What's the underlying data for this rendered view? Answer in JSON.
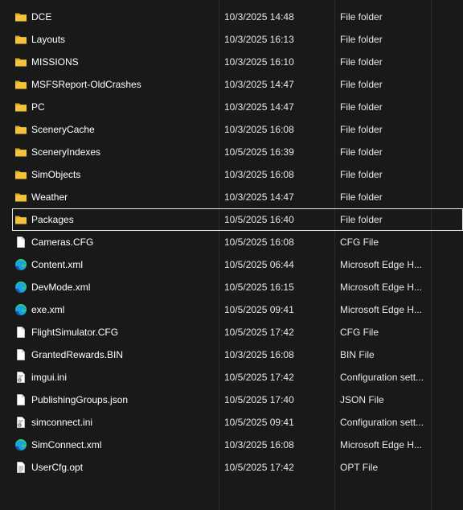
{
  "files": [
    {
      "name": "DCE",
      "date": "10/3/2025 14:48",
      "type": "File folder",
      "icon": "folder-icon"
    },
    {
      "name": "Layouts",
      "date": "10/3/2025 16:13",
      "type": "File folder",
      "icon": "folder-icon"
    },
    {
      "name": "MISSIONS",
      "date": "10/3/2025 16:10",
      "type": "File folder",
      "icon": "folder-icon"
    },
    {
      "name": "MSFSReport-OldCrashes",
      "date": "10/3/2025 14:47",
      "type": "File folder",
      "icon": "folder-icon"
    },
    {
      "name": "PC",
      "date": "10/3/2025 14:47",
      "type": "File folder",
      "icon": "folder-icon"
    },
    {
      "name": "SceneryCache",
      "date": "10/3/2025 16:08",
      "type": "File folder",
      "icon": "folder-icon"
    },
    {
      "name": "SceneryIndexes",
      "date": "10/5/2025 16:39",
      "type": "File folder",
      "icon": "folder-icon"
    },
    {
      "name": "SimObjects",
      "date": "10/3/2025 16:08",
      "type": "File folder",
      "icon": "folder-icon"
    },
    {
      "name": "Weather",
      "date": "10/3/2025 14:47",
      "type": "File folder",
      "icon": "folder-icon"
    },
    {
      "name": "Packages",
      "date": "10/5/2025 16:40",
      "type": "File folder",
      "icon": "folder-icon",
      "focused": true
    },
    {
      "name": "Cameras.CFG",
      "date": "10/5/2025 16:08",
      "type": "CFG File",
      "icon": "file-icon"
    },
    {
      "name": "Content.xml",
      "date": "10/5/2025 06:44",
      "type": "Microsoft Edge H...",
      "icon": "edge-icon"
    },
    {
      "name": "DevMode.xml",
      "date": "10/5/2025 16:15",
      "type": "Microsoft Edge H...",
      "icon": "edge-icon"
    },
    {
      "name": "exe.xml",
      "date": "10/5/2025 09:41",
      "type": "Microsoft Edge H...",
      "icon": "edge-icon"
    },
    {
      "name": "FlightSimulator.CFG",
      "date": "10/5/2025 17:42",
      "type": "CFG File",
      "icon": "file-icon"
    },
    {
      "name": "GrantedRewards.BIN",
      "date": "10/3/2025 16:08",
      "type": "BIN File",
      "icon": "file-icon"
    },
    {
      "name": "imgui.ini",
      "date": "10/5/2025 17:42",
      "type": "Configuration sett...",
      "icon": "config-file-icon"
    },
    {
      "name": "PublishingGroups.json",
      "date": "10/5/2025 17:40",
      "type": "JSON File",
      "icon": "file-icon"
    },
    {
      "name": "simconnect.ini",
      "date": "10/5/2025 09:41",
      "type": "Configuration sett...",
      "icon": "config-file-icon"
    },
    {
      "name": "SimConnect.xml",
      "date": "10/3/2025 16:08",
      "type": "Microsoft Edge H...",
      "icon": "edge-icon"
    },
    {
      "name": "UserCfg.opt",
      "date": "10/5/2025 17:42",
      "type": "OPT File",
      "icon": "text-file-icon"
    }
  ],
  "colors": {
    "background": "#191919",
    "folder": "#f5c33b",
    "edge": "#1da1e6",
    "focus_outline": "#e6e6e6"
  }
}
